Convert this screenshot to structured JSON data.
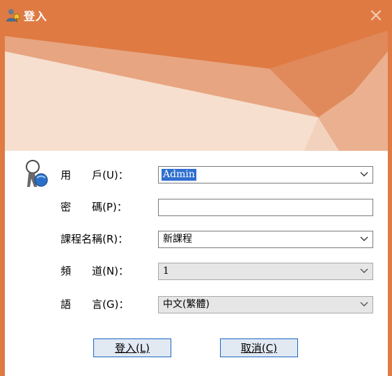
{
  "window": {
    "title": "登入",
    "icon": "user-keys-icon",
    "close_icon": "close-icon",
    "accent_color": "#df7a43"
  },
  "form": {
    "user_label": "用　　戶(U)：",
    "user_value": "Admin",
    "password_label": "密　　碼(P)：",
    "password_value": "",
    "course_label": "課程名稱(R)：",
    "course_value": "新課程",
    "channel_label": "頻　　道(N)：",
    "channel_value": "1",
    "language_label": "語　　言(G)：",
    "language_value": "中文(繁體)"
  },
  "buttons": {
    "login_label": "登入(L)",
    "cancel_label": "取消(C)"
  }
}
